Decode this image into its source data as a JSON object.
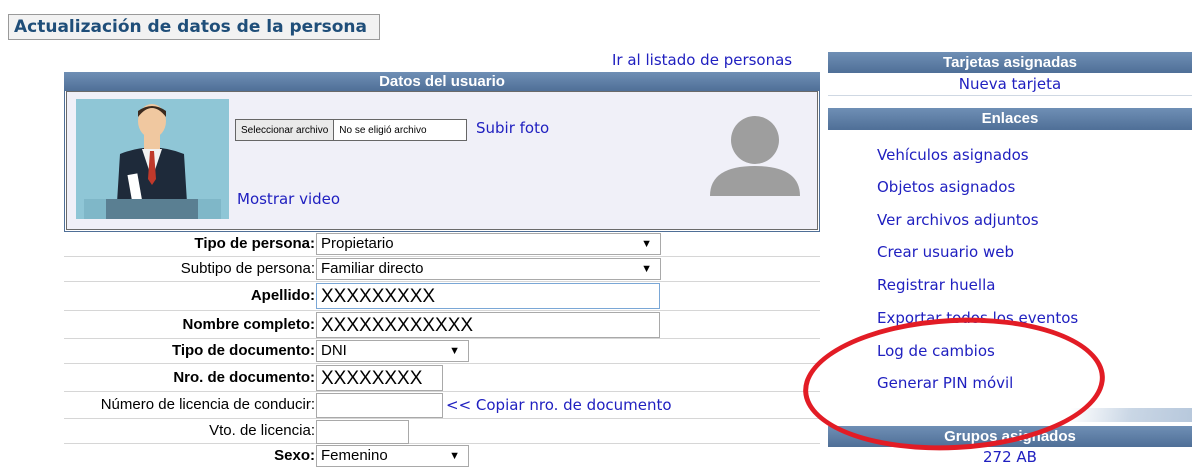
{
  "page_title": "Actualización de datos de la persona",
  "list_link": "Ir al listado de personas",
  "user_section": {
    "header": "Datos del usuario",
    "file_button": "Seleccionar archivo",
    "file_status": "No se eligió archivo",
    "upload_link": "Subir foto",
    "video_link": "Mostrar video"
  },
  "form": {
    "tipo_persona": {
      "label": "Tipo de persona:",
      "value": "Propietario"
    },
    "subtipo_persona": {
      "label": "Subtipo de persona:",
      "value": "Familiar directo"
    },
    "apellido": {
      "label": "Apellido:",
      "value": "XXXXXXXXX"
    },
    "nombre": {
      "label": "Nombre completo:",
      "value": "XXXXXXXXXXXX"
    },
    "tipo_documento": {
      "label": "Tipo de documento:",
      "value": "DNI"
    },
    "nro_documento": {
      "label": "Nro. de documento:",
      "value": "XXXXXXXX"
    },
    "licencia": {
      "label": "Número de licencia de conducir:",
      "value": ""
    },
    "copy_link": "<< Copiar nro. de documento",
    "vto_licencia": {
      "label": "Vto. de licencia:",
      "value": ""
    },
    "sexo": {
      "label": "Sexo:",
      "value": "Femenino"
    }
  },
  "sidebar": {
    "cards_header": "Tarjetas asignadas",
    "new_card": "Nueva tarjeta",
    "links_header": "Enlaces",
    "links": [
      "Vehículos asignados",
      "Objetos asignados",
      "Ver archivos adjuntos",
      "Crear usuario web",
      "Registrar huella",
      "Exportar todos los eventos",
      "Log de cambios",
      "Generar PIN móvil"
    ],
    "groups_header": "Grupos asignados",
    "group_item": "272 AB"
  },
  "colors": {
    "header_blue": "#4f6f97",
    "link": "#2020c0",
    "annotation_red": "#e21c25"
  }
}
